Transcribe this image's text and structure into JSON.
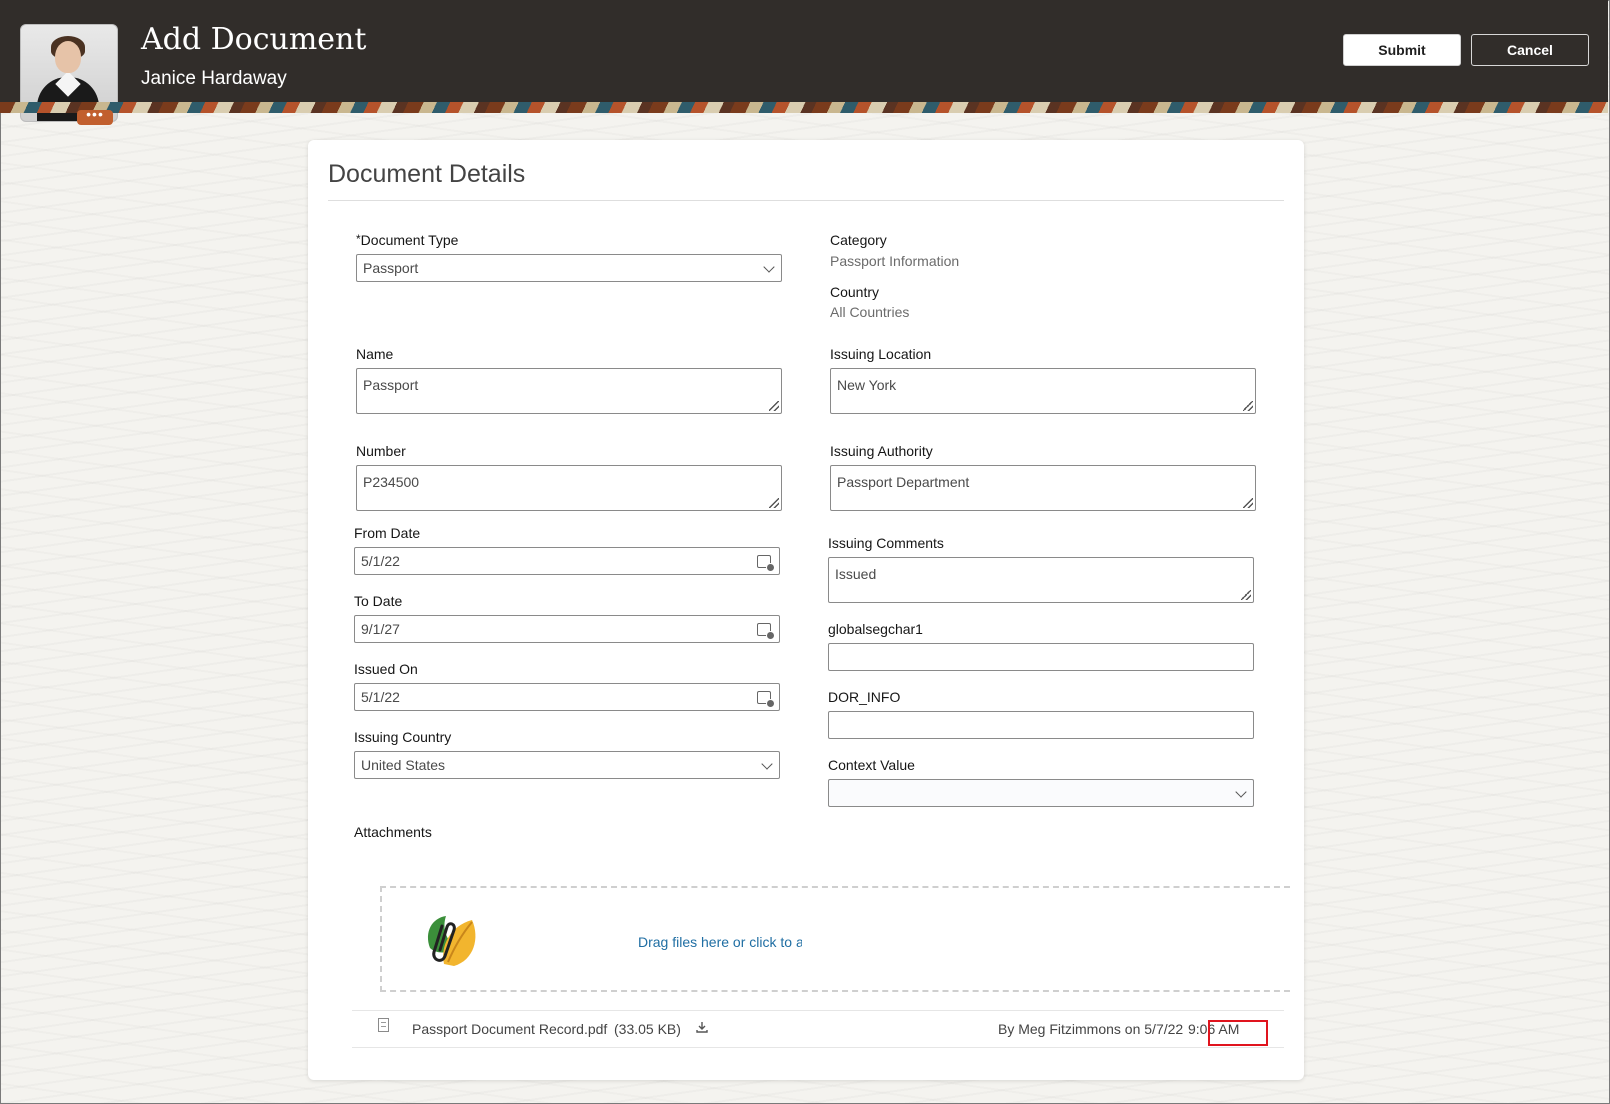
{
  "header": {
    "title": "Add Document",
    "subtitle": "Janice Hardaway",
    "avatar_more": "•••",
    "submit_label": "Submit",
    "cancel_label": "Cancel"
  },
  "card": {
    "title": "Document Details"
  },
  "form": {
    "document_type": {
      "required_mark": "*",
      "label": "Document Type",
      "value": "Passport"
    },
    "category": {
      "label": "Category",
      "value": "Passport Information"
    },
    "country": {
      "label": "Country",
      "value": "All Countries"
    },
    "name": {
      "label": "Name",
      "value": "Passport"
    },
    "issuing_location": {
      "label": "Issuing Location",
      "value": "New York"
    },
    "number": {
      "label": "Number",
      "value": "P234500"
    },
    "issuing_authority": {
      "label": "Issuing Authority",
      "value": "Passport Department"
    },
    "from_date": {
      "label": "From Date",
      "value": "5/1/22"
    },
    "issuing_comments": {
      "label": "Issuing Comments",
      "value": "Issued"
    },
    "to_date": {
      "label": "To Date",
      "value": "9/1/27"
    },
    "globalsegchar1": {
      "label": "globalsegchar1",
      "value": ""
    },
    "issued_on": {
      "label": "Issued On",
      "value": "5/1/22"
    },
    "dor_info": {
      "label": "DOR_INFO",
      "value": ""
    },
    "issuing_country": {
      "label": "Issuing Country",
      "value": "United States"
    },
    "context_value": {
      "label": "Context Value",
      "value": ""
    }
  },
  "attachments": {
    "label": "Attachments",
    "drop_text": "Drag files here or click to add attachment",
    "file": {
      "name": "Passport Document Record.pdf",
      "size": "(33.05 KB)",
      "by": "By Meg Fitzimmons on 5/7/22",
      "time": "9:06 AM"
    }
  },
  "icons": [
    "calendar-icon",
    "chevron-down-icon",
    "download-icon",
    "file-icon",
    "leaf-paperclip-icon",
    "resize-handle-icon"
  ],
  "colors": {
    "header_bg": "#312d2a",
    "link": "#1f6ea3",
    "highlight": "#e0141e",
    "accent_orange": "#c15f2e"
  }
}
